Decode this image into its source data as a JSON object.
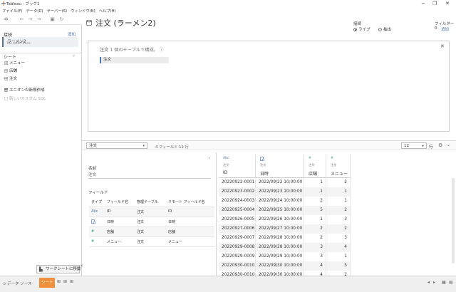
{
  "window": {
    "title": "Tableau - ブック1",
    "minimize": "─",
    "maximize": "❐",
    "close": "✕"
  },
  "menu": [
    "ファイル(F)",
    "データ(D)",
    "サーバー(S)",
    "ウィンドウ(N)",
    "ヘルプ(H)"
  ],
  "left": {
    "connections_label": "接続",
    "add_label": "追加",
    "connection": {
      "name": "ラーメン2",
      "type": "Microsoft Excel"
    },
    "sheets_label": "シート",
    "sheets": [
      "メニュー",
      "店舗",
      "注文"
    ],
    "new_union": "ユニオンの新規作成",
    "new_custom_sql": "新しいカスタム SQL"
  },
  "header": {
    "title": "注文 (ラーメン2)",
    "connection_label": "接続",
    "live_label": "ライブ",
    "extract_label": "抽出",
    "filter_label": "フィルター",
    "filter_count": "0",
    "filter_add": "追加"
  },
  "canvas": {
    "hint": "注文",
    "hint_suffix": "1 個のテーブルで構成。",
    "info_icon": "ⓘ",
    "table": "注文"
  },
  "midbar": {
    "table_select": "注文",
    "field_count": "4 フィールド 12 行",
    "rows_value": "12",
    "rows_unit": "行"
  },
  "meta": {
    "name_label": "名前",
    "name_value": "注文",
    "fields_label": "フィールド",
    "columns": [
      "タイプ",
      "フィールド名",
      "物理テーブル",
      "リモート フィールド名"
    ],
    "rows": [
      {
        "type": "Abc",
        "field": "ID",
        "table": "注文",
        "remote": "ID"
      },
      {
        "type": "date",
        "field": "日時",
        "table": "注文",
        "remote": "日時"
      },
      {
        "type": "#",
        "field": "店舗",
        "table": "注文",
        "remote": "店舗"
      },
      {
        "type": "#",
        "field": "メニュー",
        "table": "注文",
        "remote": "メニュー"
      }
    ]
  },
  "grid": {
    "columns": [
      {
        "icon": "Abc",
        "table": "注文",
        "name": "ID"
      },
      {
        "icon": "date",
        "table": "注文",
        "name": "日時"
      },
      {
        "icon": "#",
        "table": "注文",
        "name": "店舗"
      },
      {
        "icon": "#",
        "table": "注文",
        "name": "メニュー"
      }
    ],
    "rows": [
      [
        "20220922-0001",
        "2022/09/22 10:00:00",
        "1",
        "2"
      ],
      [
        "20220923-0002",
        "2022/09/23 10:00:00",
        "1",
        "1"
      ],
      [
        "20220924-0003",
        "2022/09/24 10:00:00",
        "2",
        "1"
      ],
      [
        "20220925-0004",
        "2022/09/25 10:00:00",
        "5",
        "2"
      ],
      [
        "20220926-0005",
        "2022/09/26 10:00:00",
        "1",
        "3"
      ],
      [
        "20220927-0006",
        "2022/09/27 10:00:00",
        "2",
        "2"
      ],
      [
        "20220929-0007",
        "2022/09/28 10:00:00",
        "2",
        "3"
      ],
      [
        "20220929-0008",
        "2022/09/28 10:00:00",
        "3",
        "4"
      ],
      [
        "20220929-0009",
        "2022/09/29 10:00:00",
        "3",
        "1"
      ],
      [
        "20220930-0010",
        "2022/09/30 10:00:00",
        "4",
        "5"
      ],
      [
        "20220930-0010",
        "2022/09/30 10:00:00",
        "4",
        "2"
      ]
    ]
  },
  "bottom": {
    "data_source_tab": "データ ソース",
    "sheet_tab": "シート 1",
    "goto_worksheet": "ワークシートに移動"
  },
  "colors": {
    "accent": "#4c77a6",
    "sheet_tab": "#f08f3c"
  }
}
